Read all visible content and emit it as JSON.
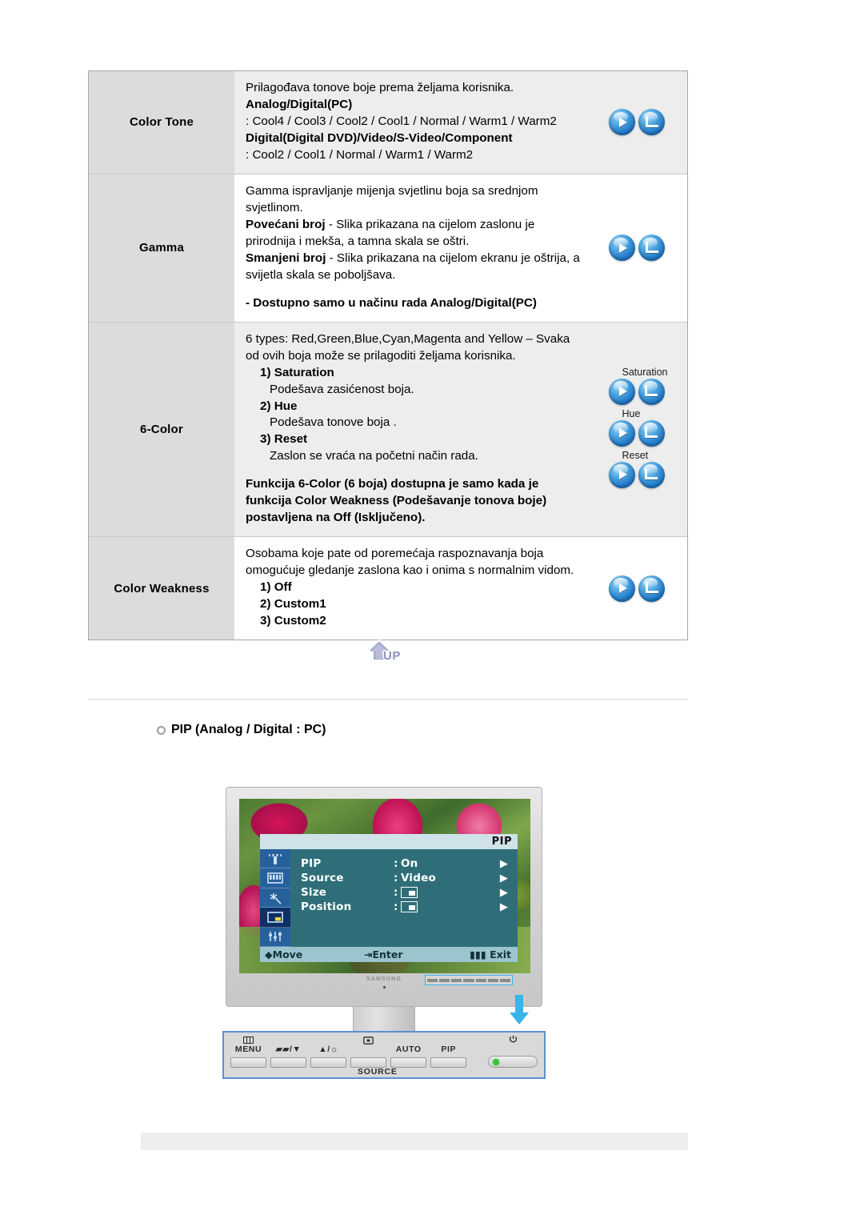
{
  "table": {
    "rows": [
      {
        "name": "Color Tone",
        "lines": [
          {
            "text": "Prilagođava tonove boje prema željama korisnika.",
            "style": "normal"
          },
          {
            "text": "Analog/Digital(PC)",
            "style": "bold"
          },
          {
            "text": ": Cool4 / Cool3 / Cool2 / Cool1 / Normal / Warm1 / Warm2",
            "style": "normal"
          },
          {
            "text": "Digital(Digital DVD)/Video/S-Video/Component",
            "style": "bold"
          },
          {
            "text": ": Cool2 / Cool1 / Normal / Warm1 / Warm2",
            "style": "normal"
          }
        ],
        "buttons": [
          {
            "label": "",
            "icons": [
              "play-icon",
              "enter-icon"
            ]
          }
        ]
      },
      {
        "name": "Gamma",
        "lines": [
          {
            "text": "Gamma ispravljanje mijenja svjetlinu boja sa srednjom svjetlinom.",
            "style": "normal"
          },
          {
            "text": "Povećani broj - Slika prikazana na cijelom zaslonu je prirodnija i mekša, a tamna skala se oštri.",
            "style": "leadbold",
            "lead": "Povećani broj"
          },
          {
            "text": "Smanjeni broj - Slika prikazana na cijelom ekranu je oštrija, a svijetla skala se poboljšava.",
            "style": "leadbold",
            "lead": "Smanjeni broj"
          },
          {
            "text": "",
            "style": "spacer"
          },
          {
            "text": "- Dostupno samo u načinu rada Analog/Digital(PC)",
            "style": "bold"
          }
        ],
        "buttons": [
          {
            "label": "",
            "icons": [
              "play-icon",
              "enter-icon"
            ]
          }
        ]
      },
      {
        "name": "6-Color",
        "lines": [
          {
            "text": "6 types: Red,Green,Blue,Cyan,Magenta and Yellow – Svaka od ovih boja može se prilagoditi željama korisnika.",
            "style": "normal"
          },
          {
            "text": "1) Saturation",
            "style": "bold-indent1"
          },
          {
            "text": "Podešava zasićenost boja.",
            "style": "normal-indent2"
          },
          {
            "text": "2) Hue",
            "style": "bold-indent1"
          },
          {
            "text": "Podešava tonove boja .",
            "style": "normal-indent2"
          },
          {
            "text": "3) Reset",
            "style": "bold-indent1"
          },
          {
            "text": "Zaslon se vraća na početni način rada.",
            "style": "normal-indent2"
          },
          {
            "text": "",
            "style": "spacer"
          },
          {
            "text": "Funkcija 6-Color (6 boja) dostupna je samo kada je funkcija Color Weakness (Podešavanje tonova boje) postavljena na Off (Isključeno).",
            "style": "bold"
          }
        ],
        "buttons": [
          {
            "label": "Saturation",
            "icons": [
              "play-icon",
              "enter-icon"
            ]
          },
          {
            "label": "Hue",
            "icons": [
              "play-icon",
              "enter-icon"
            ]
          },
          {
            "label": "Reset",
            "icons": [
              "play-icon",
              "enter-icon"
            ]
          }
        ]
      },
      {
        "name": "Color Weakness",
        "lines": [
          {
            "text": "Osobama koje pate od poremećaja raspoznavanja boja omogućuje gledanje zaslona kao i onima s normalnim vidom.",
            "style": "normal"
          },
          {
            "text": "1) Off",
            "style": "bold-indent1"
          },
          {
            "text": "2) Custom1",
            "style": "bold-indent1"
          },
          {
            "text": "3) Custom2",
            "style": "bold-indent1"
          }
        ],
        "buttons": [
          {
            "label": "",
            "icons": [
              "play-icon",
              "enter-icon"
            ]
          }
        ]
      }
    ]
  },
  "up_button": {
    "label": "UP",
    "icon": "up-arrow-icon"
  },
  "section": {
    "heading": "PIP (Analog / Digital : PC)",
    "bullet_icon": "ring-bullet-icon"
  },
  "monitor": {
    "brand": "SAMSUNG",
    "osd": {
      "title": "PIP",
      "side_icons": [
        "picture-icon",
        "color-icon",
        "image-icon",
        "pip-icon",
        "setup-icon"
      ],
      "selected_side_icon_index": 3,
      "items": [
        {
          "label": "PIP",
          "colon": ":",
          "value": "On",
          "value_type": "text",
          "arrow": "▶"
        },
        {
          "label": "Source",
          "colon": ":",
          "value": "Video",
          "value_type": "text",
          "arrow": "▶"
        },
        {
          "label": "Size",
          "colon": ":",
          "value": "",
          "value_type": "box",
          "arrow": "▶"
        },
        {
          "label": "Position",
          "colon": ":",
          "value": "",
          "value_type": "box",
          "arrow": "▶"
        }
      ],
      "footer": [
        {
          "icon": "updown-icon",
          "label": "Move"
        },
        {
          "icon": "enter-key-icon",
          "label": "Enter"
        },
        {
          "icon": "menu-key-icon",
          "label": "Exit"
        }
      ]
    }
  },
  "control_panel": {
    "keys": [
      {
        "icon": "menu-grid-icon",
        "label": "MENU"
      },
      {
        "icon": "",
        "label": "▰▰/▼"
      },
      {
        "icon": "",
        "label": "▲/☼"
      },
      {
        "icon": "source-icon",
        "label": ""
      },
      {
        "icon": "",
        "label": "AUTO"
      },
      {
        "icon": "",
        "label": "PIP"
      },
      {
        "icon": "power-icon",
        "label": ""
      }
    ],
    "source_label": "SOURCE"
  },
  "colors": {
    "table_header_bg": "#dcdcdc",
    "table_alt_bg": "#ededed",
    "table_border": "#a8a8a8",
    "osd_bg": "#2f6e78",
    "osd_side": "#27619c",
    "osd_title_bg": "#cfe2e8",
    "osd_footer_bg": "#9cc4cf",
    "callout_border": "#5b8fd6",
    "accent_blue": "#39b4e8"
  }
}
